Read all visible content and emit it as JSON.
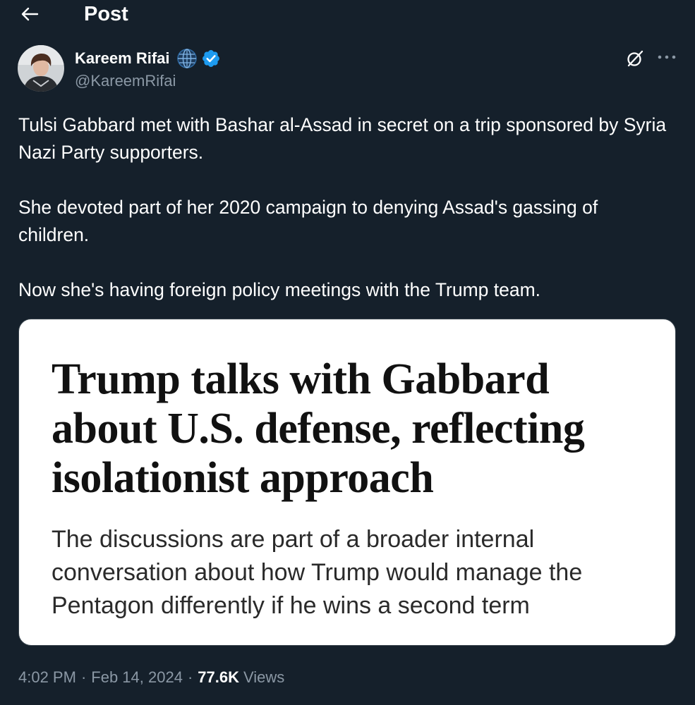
{
  "header": {
    "title": "Post",
    "back_icon": "arrow-left-icon"
  },
  "author": {
    "name": "Kareem Rifai",
    "handle": "@KareemRifai",
    "badges": [
      "globe-icon",
      "verified-icon"
    ],
    "verified_color": "#1d9bf0"
  },
  "actions": {
    "grok_icon": "grok-icon",
    "more_icon": "more-horizontal-icon"
  },
  "post": {
    "paragraphs": [
      "Tulsi Gabbard met with Bashar al-Assad in secret on a trip sponsored by Syria Nazi Party supporters.",
      "She devoted part of her 2020 campaign to denying Assad's gassing of children.",
      "Now she's having foreign policy meetings with the Trump team."
    ],
    "media": {
      "headline": "Trump talks with Gabbard about U.S. defense, reflecting isolationist approach",
      "subheadline": "The discussions are part of a broader internal conversation about how Trump would manage the Pentagon differently if he wins a second term"
    },
    "meta": {
      "time": "4:02 PM",
      "date": "Feb 14, 2024",
      "separator": "·",
      "views_count": "77.6K",
      "views_label": "Views"
    }
  },
  "colors": {
    "background": "#15202b",
    "text_primary": "#ffffff",
    "text_secondary": "#8b98a5",
    "accent": "#1d9bf0"
  }
}
